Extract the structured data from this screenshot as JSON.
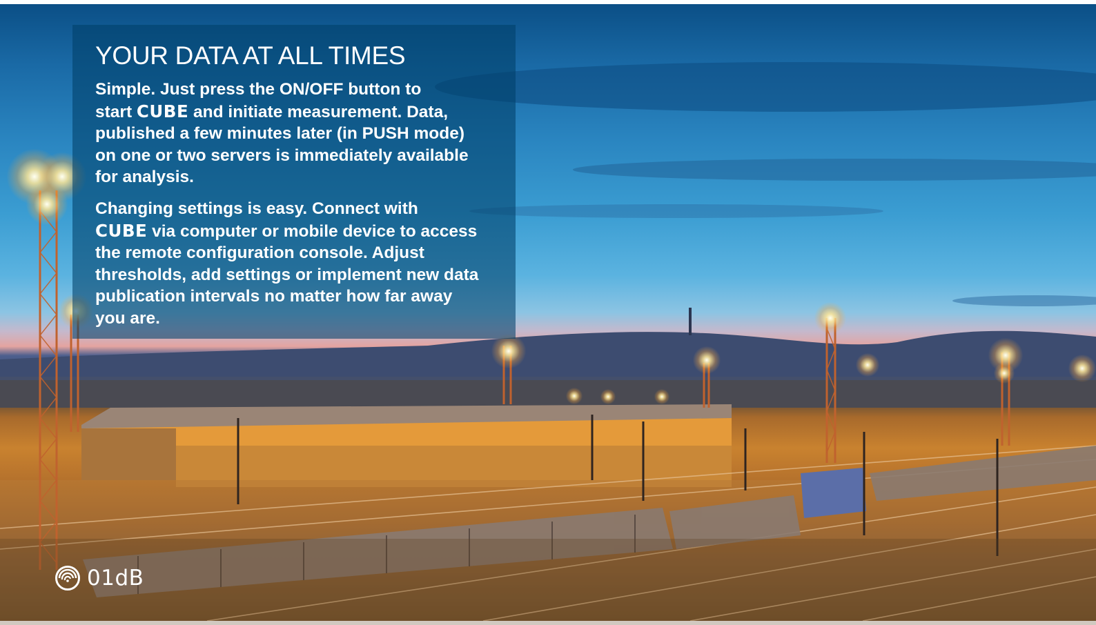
{
  "panel": {
    "heading": "YOUR DATA AT ALL TIMES",
    "paragraph1": {
      "before": "Simple. Just press the ON/OFF button to\nstart ",
      "brand": "CUBE",
      "after": " and initiate measurement. Data,\npublished a few minutes later (in PUSH mode)\non one or two servers is immediately available\nfor analysis."
    },
    "paragraph2": {
      "before": "Changing settings is easy.  Connect with\n",
      "brand": "CUBE",
      "after": " via computer or mobile device to access\nthe remote configuration console. Adjust\nthresholds, add settings or implement new data\npublication intervals no matter how far away\nyou are."
    }
  },
  "logo": {
    "text": "01dB",
    "icon": "01db-spiral-logo-icon"
  },
  "colors": {
    "panel_overlay": "#003f69",
    "text": "#ffffff",
    "sky_top": "#0b4f86",
    "horizon_glow": "#e4a4a0",
    "ground_orange": "#c9822f"
  }
}
